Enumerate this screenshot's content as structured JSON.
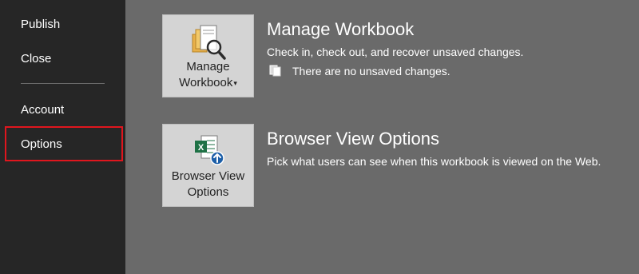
{
  "sidebar": {
    "items": [
      {
        "label": "Publish"
      },
      {
        "label": "Close"
      },
      {
        "label": "Account"
      },
      {
        "label": "Options"
      }
    ],
    "highlight_color": "#e0161e"
  },
  "manage": {
    "tile_line1": "Manage",
    "tile_line2": "Workbook",
    "title": "Manage Workbook",
    "description": "Check in, check out, and recover unsaved changes.",
    "status": "There are no unsaved changes."
  },
  "browser": {
    "tile_line1": "Browser View",
    "tile_line2": "Options",
    "title": "Browser View Options",
    "description": "Pick what users can see when this workbook is viewed on the Web."
  },
  "colors": {
    "sidebar_bg": "#262626",
    "main_bg": "#6a6a6a",
    "tile_bg": "#d4d4d4",
    "excel_green": "#1e7145",
    "info_blue": "#1d5fa8"
  }
}
